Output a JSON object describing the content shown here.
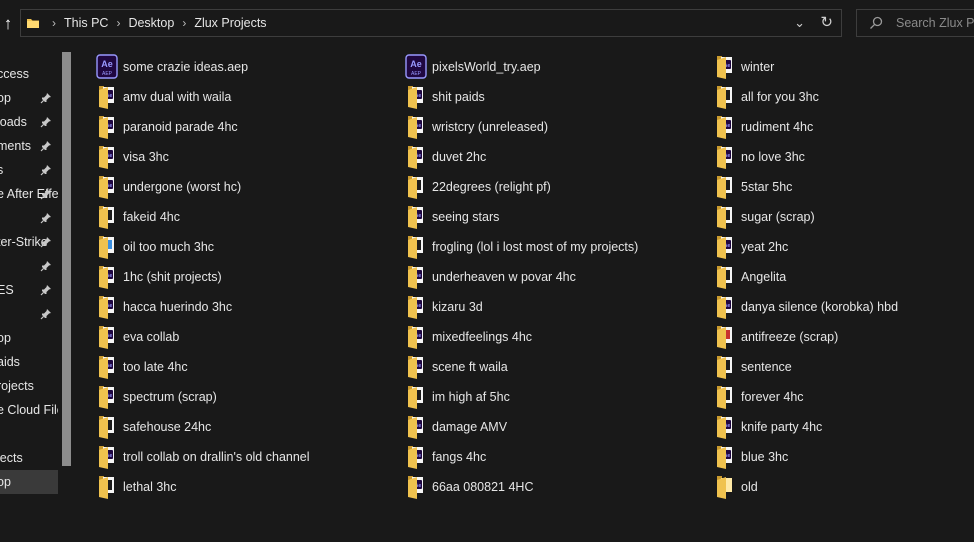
{
  "breadcrumb": {
    "items": [
      "This PC",
      "Desktop",
      "Zlux Projects"
    ]
  },
  "search": {
    "placeholder": "Search Zlux Projects"
  },
  "nav": {
    "items": [
      {
        "label": "ccess",
        "pinned": false
      },
      {
        "label": "op",
        "pinned": true
      },
      {
        "label": "loads",
        "pinned": true
      },
      {
        "label": "ments",
        "pinned": true
      },
      {
        "label": "s",
        "pinned": true
      },
      {
        "label": "e After Effects",
        "pinned": true
      },
      {
        "label": "",
        "pinned": true
      },
      {
        "label": "ter-Strike",
        "pinned": true
      },
      {
        "label": "",
        "pinned": true
      },
      {
        "label": "ES",
        "pinned": true
      },
      {
        "label": "",
        "pinned": true
      },
      {
        "label": "op",
        "pinned": false
      },
      {
        "label": "aids",
        "pinned": false
      },
      {
        "label": "rojects",
        "pinned": false
      },
      {
        "label": "e Cloud Files",
        "pinned": false
      },
      {
        "label": "",
        "pinned": false
      },
      {
        "label": "jects",
        "pinned": false
      },
      {
        "label": "op",
        "pinned": false,
        "selected": true
      }
    ]
  },
  "files": {
    "columns": [
      [
        {
          "name": "some crazie ideas.aep",
          "type": "aep"
        },
        {
          "name": "amv dual with waila",
          "type": "folder-ae"
        },
        {
          "name": "paranoid parade 4hc",
          "type": "folder-ae"
        },
        {
          "name": "visa 3hc",
          "type": "folder-ae"
        },
        {
          "name": "undergone (worst hc)",
          "type": "folder-ae"
        },
        {
          "name": "fakeid 4hc",
          "type": "folder"
        },
        {
          "name": "oil too much 3hc",
          "type": "folder-blue"
        },
        {
          "name": "1hc (shit projects)",
          "type": "folder-ae"
        },
        {
          "name": "hacca huerindo 3hc",
          "type": "folder-ae"
        },
        {
          "name": "eva collab",
          "type": "folder-ae"
        },
        {
          "name": "too late 4hc",
          "type": "folder-ae"
        },
        {
          "name": "spectrum (scrap)",
          "type": "folder-ae"
        },
        {
          "name": "safehouse 24hc",
          "type": "folder"
        },
        {
          "name": "troll collab on drallin's old channel",
          "type": "folder-ae"
        },
        {
          "name": "lethal 3hc",
          "type": "folder"
        }
      ],
      [
        {
          "name": "pixelsWorld_try.aep",
          "type": "aep"
        },
        {
          "name": "shit paids",
          "type": "folder-ae"
        },
        {
          "name": "wristcry (unreleased)",
          "type": "folder-ae"
        },
        {
          "name": "duvet 2hc",
          "type": "folder-ae"
        },
        {
          "name": "22degrees (relight pf)",
          "type": "folder"
        },
        {
          "name": "seeing stars",
          "type": "folder-ae"
        },
        {
          "name": "frogling (lol i lost most of my projects)",
          "type": "folder"
        },
        {
          "name": "underheaven w povar 4hc",
          "type": "folder-ae"
        },
        {
          "name": "kizaru 3d",
          "type": "folder-ae"
        },
        {
          "name": "mixedfeelings 4hc",
          "type": "folder-ae"
        },
        {
          "name": "scene ft waila",
          "type": "folder-ae"
        },
        {
          "name": "im high af 5hc",
          "type": "folder"
        },
        {
          "name": "damage AMV",
          "type": "folder-ae"
        },
        {
          "name": "fangs 4hc",
          "type": "folder-ae"
        },
        {
          "name": "66aa 080821 4HC",
          "type": "folder-ae"
        }
      ],
      [
        {
          "name": "winter",
          "type": "folder-ae"
        },
        {
          "name": "all for you 3hc",
          "type": "folder"
        },
        {
          "name": "rudiment 4hc",
          "type": "folder-ae"
        },
        {
          "name": "no love 3hc",
          "type": "folder-ae"
        },
        {
          "name": "5star 5hc",
          "type": "folder"
        },
        {
          "name": "sugar (scrap)",
          "type": "folder"
        },
        {
          "name": "yeat 2hc",
          "type": "folder-ae"
        },
        {
          "name": "Angelita",
          "type": "folder"
        },
        {
          "name": "danya silence (korobka) hbd",
          "type": "folder-ae"
        },
        {
          "name": "antifreeze (scrap)",
          "type": "folder-red"
        },
        {
          "name": "sentence",
          "type": "folder"
        },
        {
          "name": "forever 4hc",
          "type": "folder"
        },
        {
          "name": "knife party 4hc",
          "type": "folder-ae"
        },
        {
          "name": "blue 3hc",
          "type": "folder-ae"
        },
        {
          "name": "old",
          "type": "folder-plain"
        }
      ]
    ]
  },
  "colors": {
    "background": "#191919",
    "text": "#e6e6e6",
    "folder": "#f0c24e",
    "ae_purple": "#9999ff",
    "ae_bg": "#1f0740"
  }
}
